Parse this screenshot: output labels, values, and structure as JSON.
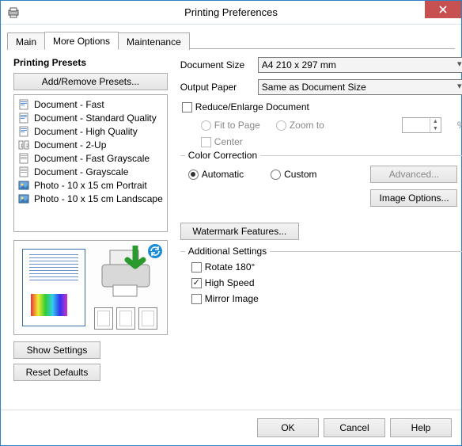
{
  "window": {
    "title": "Printing Preferences"
  },
  "tabs": {
    "main": "Main",
    "more_options": "More Options",
    "maintenance": "Maintenance"
  },
  "presets": {
    "heading": "Printing Presets",
    "add_remove": "Add/Remove Presets...",
    "items": [
      {
        "label": "Document - Fast",
        "icon": "doc"
      },
      {
        "label": "Document - Standard Quality",
        "icon": "doc"
      },
      {
        "label": "Document - High Quality",
        "icon": "doc"
      },
      {
        "label": "Document - 2-Up",
        "icon": "2up"
      },
      {
        "label": "Document - Fast Grayscale",
        "icon": "gray"
      },
      {
        "label": "Document - Grayscale",
        "icon": "gray"
      },
      {
        "label": "Photo - 10 x 15 cm Portrait",
        "icon": "photo"
      },
      {
        "label": "Photo - 10 x 15 cm Landscape",
        "icon": "photo"
      }
    ]
  },
  "buttons": {
    "show_settings": "Show Settings",
    "reset_defaults": "Reset Defaults",
    "ok": "OK",
    "cancel": "Cancel",
    "help": "Help",
    "advanced": "Advanced...",
    "image_options": "Image Options...",
    "watermark": "Watermark Features..."
  },
  "labels": {
    "document_size": "Document Size",
    "output_paper": "Output Paper",
    "reduce_enlarge": "Reduce/Enlarge Document",
    "fit_to_page": "Fit to Page",
    "zoom_to": "Zoom to",
    "center": "Center",
    "percent": "%",
    "color_correction": "Color Correction",
    "automatic": "Automatic",
    "custom": "Custom",
    "additional_settings": "Additional Settings",
    "rotate180": "Rotate 180°",
    "high_speed": "High Speed",
    "mirror_image": "Mirror Image"
  },
  "values": {
    "document_size": "A4 210 x 297 mm",
    "output_paper": "Same as Document Size",
    "reduce_enlarge_checked": false,
    "center_checked": false,
    "color_correction": "automatic",
    "zoom_value": "",
    "rotate180": false,
    "high_speed": true,
    "mirror_image": false
  }
}
